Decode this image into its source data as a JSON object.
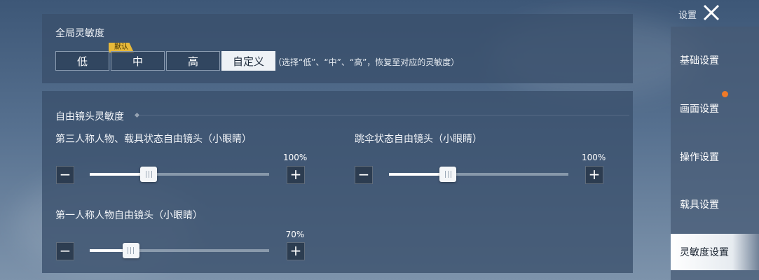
{
  "header": {
    "settings_label": "设置"
  },
  "global_sensitivity": {
    "title": "全局灵敏度",
    "options": [
      "低",
      "中",
      "高",
      "自定义"
    ],
    "selected": "自定义",
    "default_badge": "默认",
    "hint": "（选择“低”、“中”、“高”，恢复至对应的灵敏度）"
  },
  "free_camera": {
    "title": "自由镜头灵敏度",
    "sliders": [
      {
        "label": "第三人称人物、载具状态自由镜头（小眼睛）",
        "value_text": "100%",
        "value": 100,
        "fill_fraction": 0.33
      },
      {
        "label": "跳伞状态自由镜头（小眼睛）",
        "value_text": "100%",
        "value": 100,
        "fill_fraction": 0.33
      },
      {
        "label": "第一人称人物自由镜头（小眼睛）",
        "value_text": "70%",
        "value": 70,
        "fill_fraction": 0.23
      }
    ],
    "minus_symbol": "−",
    "plus_symbol": "+"
  },
  "sidebar": {
    "items": [
      {
        "label": "基础设置",
        "active": false
      },
      {
        "label": "画面设置",
        "active": false,
        "notification": true
      },
      {
        "label": "操作设置",
        "active": false
      },
      {
        "label": "载具设置",
        "active": false
      },
      {
        "label": "灵敏度设置",
        "active": true
      }
    ]
  },
  "colors": {
    "accent_badge": "#e8b93a",
    "notification_dot": "#f07a28",
    "selected_button": "#eef2f6"
  },
  "icons": {
    "close": "close-icon",
    "thumb": "slider-grip-icon"
  }
}
